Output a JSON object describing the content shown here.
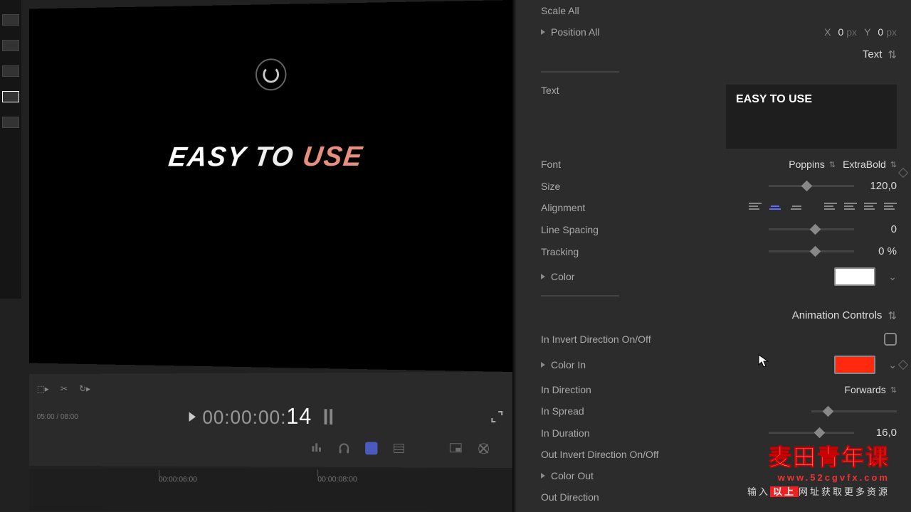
{
  "viewer": {
    "text_w1": "EASY",
    "text_w2": "TO",
    "text_w3": "USE"
  },
  "transport": {
    "timecode_prefix": "00:00:00:",
    "timecode_frames": "14",
    "duration_small": "05:00 / 08:00",
    "tl_mark1": "00:00:06:00",
    "tl_mark2": "00:00:08:00"
  },
  "inspector": {
    "scale_all_label": "Scale All",
    "position_all_label": "Position All",
    "pos_x_label": "X",
    "pos_x_val": "0",
    "pos_y_label": "Y",
    "pos_y_val": "0",
    "px_unit": "px",
    "text_section": "Text",
    "text_label": "Text",
    "text_value": "EASY TO USE",
    "font_label": "Font",
    "font_family": "Poppins",
    "font_weight": "ExtraBold",
    "size_label": "Size",
    "size_value": "120,0",
    "alignment_label": "Alignment",
    "linespacing_label": "Line Spacing",
    "linespacing_value": "0",
    "tracking_label": "Tracking",
    "tracking_value": "0",
    "tracking_unit": "%",
    "color_label": "Color",
    "color_value": "#ffffff",
    "anim_section": "Animation Controls",
    "in_invert_label": "In Invert Direction On/Off",
    "color_in_label": "Color In",
    "color_in_value": "#ff2a0e",
    "in_direction_label": "In Direction",
    "in_direction_value": "Forwards",
    "in_spread_label": "In Spread",
    "in_duration_label": "In Duration",
    "in_duration_value": "16,0",
    "out_invert_label": "Out Invert Direction On/Off",
    "color_out_label": "Color Out",
    "out_direction_label": "Out Direction"
  },
  "watermark": {
    "cn": "麦田青年课",
    "url": "www.52cgvfx.com",
    "sub_pre": "输入",
    "sub_hl": "以上",
    "sub_post": "网址获取更多资源"
  }
}
